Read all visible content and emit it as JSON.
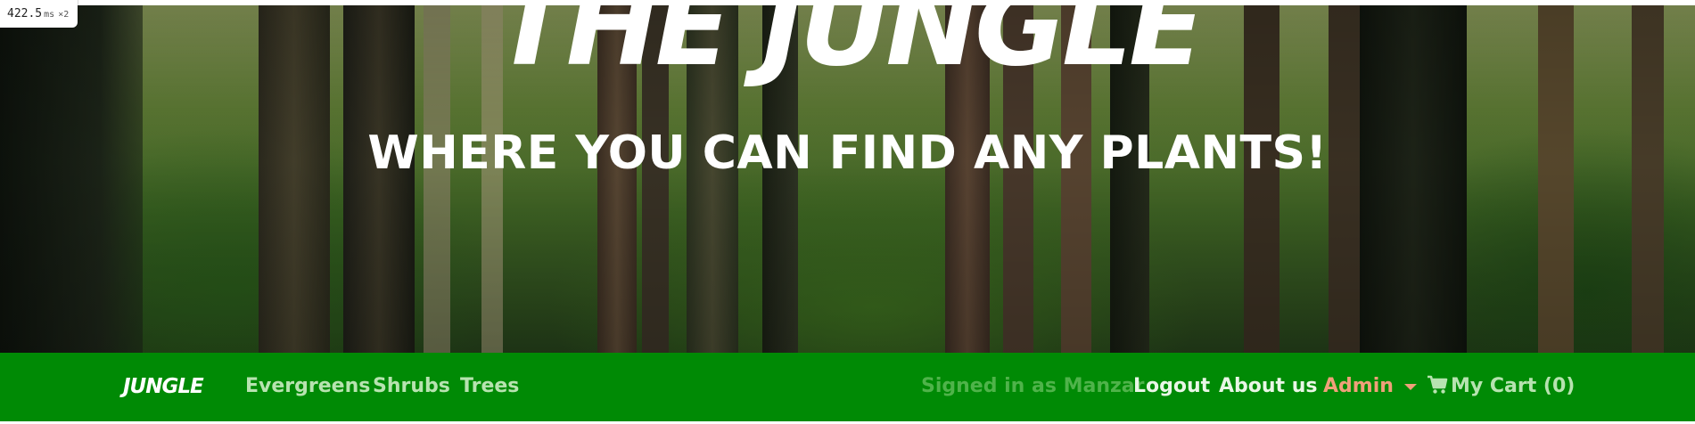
{
  "debug": {
    "value": "422.5",
    "unit": "ms",
    "multiplier": "×2"
  },
  "hero": {
    "title": "THE JUNGLE",
    "subtitle": "WHERE YOU CAN FIND ANY PLANTS!"
  },
  "navbar": {
    "background": "#008a05",
    "brand": "JUNGLE",
    "left_links": [
      "Evergreens",
      "Shrubs",
      "Trees"
    ],
    "signed_in": "Signed in as Manzar",
    "logout": "Logout",
    "about": "About us",
    "admin": "Admin",
    "cart": "My Cart (0)",
    "cart_icon": "shopping-cart-icon"
  }
}
